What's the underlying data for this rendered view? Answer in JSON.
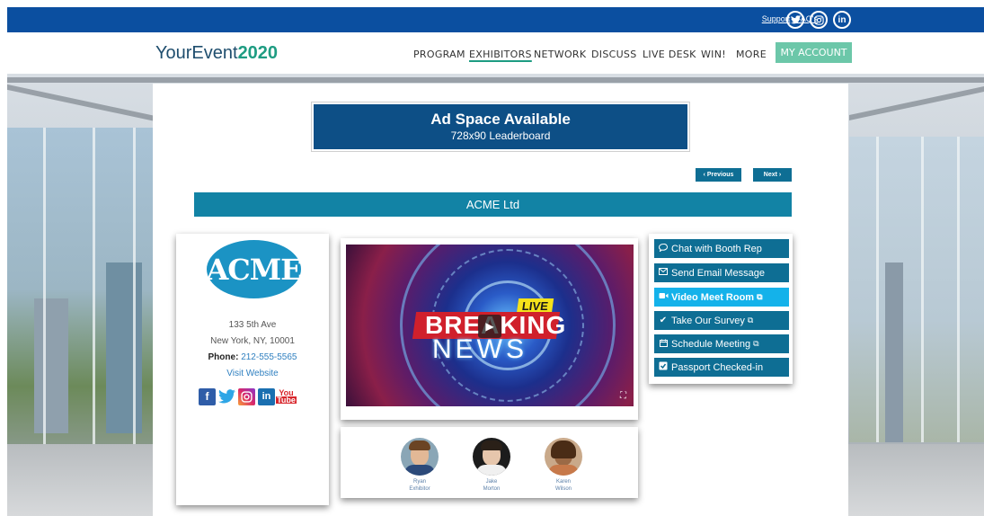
{
  "topbar": {
    "support_label": "Support",
    "faq_label": "FAQ's",
    "social_icons": [
      "twitter-icon",
      "instagram-icon",
      "linkedin-icon"
    ]
  },
  "header": {
    "brand_prefix": "YourEvent",
    "brand_suffix": "2020",
    "nav": [
      "PROGRAM",
      "EXHIBITORS",
      "NETWORK",
      "DISCUSS",
      "LIVE DESK",
      "WIN!",
      "MORE"
    ],
    "active_nav": "EXHIBITORS",
    "account_label": "MY ACCOUNT"
  },
  "ad": {
    "title": "Ad Space Available",
    "size": "728x90 Leaderboard"
  },
  "pager": {
    "previous_label": "‹ Previous",
    "next_label": "Next ›"
  },
  "exhibitor": {
    "name": "ACME Ltd",
    "logo_text": "ACME",
    "address_line1": "133 5th Ave",
    "address_line2": "New York, NY, 10001",
    "phone_label": "Phone:",
    "phone": "212-555-5565",
    "website_label": "Visit Website",
    "social_icons": [
      "facebook-icon",
      "twitter-icon",
      "instagram-icon",
      "linkedin-icon",
      "youtube-icon"
    ]
  },
  "video": {
    "live_label": "LIVE",
    "headline_1": "BREAKING",
    "headline_2": "NEWS"
  },
  "reps": [
    {
      "first": "Ryan",
      "last": "Exhibitor"
    },
    {
      "first": "Jake",
      "last": "Morton"
    },
    {
      "first": "Karen",
      "last": "Wilson"
    }
  ],
  "actions": [
    {
      "label": "Chat with Booth Rep",
      "icon": "chat-icon",
      "external": false
    },
    {
      "label": "Send Email Message",
      "icon": "envelope-icon",
      "external": false
    },
    {
      "label": "Video Meet Room",
      "icon": "video-camera-icon",
      "external": true
    },
    {
      "label": "Take Our Survey",
      "icon": "checkmark-icon",
      "external": true
    },
    {
      "label": "Schedule Meeting",
      "icon": "calendar-icon",
      "external": true
    },
    {
      "label": "Passport Checked-in",
      "icon": "checkbox-icon",
      "external": false
    }
  ],
  "colors": {
    "topbar": "#0b4fa0",
    "brand_accent": "#1e9c82",
    "account_button": "#6cc7a9",
    "primary_button": "#0e6e94",
    "highlight_button": "#14b2ea",
    "title_bar": "#1283a5"
  }
}
